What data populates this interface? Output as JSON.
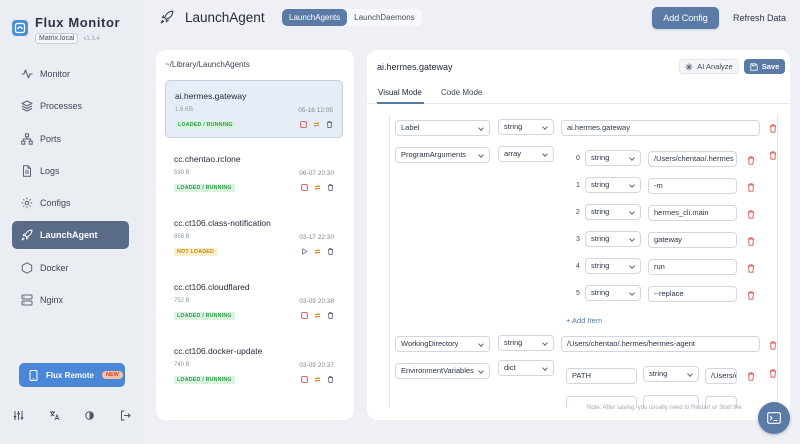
{
  "app": {
    "title": "Flux Monitor",
    "host": "Matrix.local",
    "version": "v1.3.4"
  },
  "nav": [
    {
      "label": "Monitor",
      "icon": "pulse-icon",
      "active": false
    },
    {
      "label": "Processes",
      "icon": "layers-icon",
      "active": false
    },
    {
      "label": "Ports",
      "icon": "network-icon",
      "active": false
    },
    {
      "label": "Logs",
      "icon": "file-icon",
      "active": false
    },
    {
      "label": "Configs",
      "icon": "gear-icon",
      "active": false
    },
    {
      "label": "LaunchAgent",
      "icon": "rocket-icon",
      "active": true
    },
    {
      "label": "Docker",
      "icon": "hexagon-icon",
      "active": false
    },
    {
      "label": "Nginx",
      "icon": "server-icon",
      "active": false
    }
  ],
  "remote": {
    "label": "Flux Remote",
    "badge": "NEW"
  },
  "footer_icons": [
    "sliders-icon",
    "translate-icon",
    "theme-icon",
    "logout-icon"
  ],
  "header": {
    "title": "LaunchAgent",
    "segments": [
      {
        "label": "LaunchAgents",
        "active": true
      },
      {
        "label": "LaunchDaemons",
        "active": false
      }
    ],
    "add_config": "Add Config",
    "refresh": "Refresh Data"
  },
  "list": {
    "path": "~/Library/LaunchAgents",
    "items": [
      {
        "name": "ai.hermes.gateway",
        "size": "1.6 KB",
        "date": "05-16 12:05",
        "status": "LOADED / RUNNING",
        "running": true,
        "selected": true
      },
      {
        "name": "cc.chentao.rclone",
        "size": "530 B",
        "date": "06-07 20:30",
        "status": "LOADED / RUNNING",
        "running": true,
        "selected": false
      },
      {
        "name": "cc.ct106.class-notification",
        "size": "858 B",
        "date": "03-17 22:30",
        "status": "NOT LOADED",
        "running": false,
        "selected": false
      },
      {
        "name": "cc.ct106.cloudflared",
        "size": "752 B",
        "date": "03-09 20:38",
        "status": "LOADED / RUNNING",
        "running": true,
        "selected": false
      },
      {
        "name": "cc.ct106.docker-update",
        "size": "740 B",
        "date": "03-09 20:37",
        "status": "LOADED / RUNNING",
        "running": true,
        "selected": false
      }
    ]
  },
  "detail": {
    "title": "ai.hermes.gateway",
    "ai_analyze": "AI Analyze",
    "save": "Save",
    "tabs": [
      {
        "label": "Visual Mode",
        "active": true
      },
      {
        "label": "Code Mode",
        "active": false
      }
    ],
    "rows": {
      "label": {
        "key": "Label",
        "type": "string",
        "value": "ai.hermes.gateway"
      },
      "program_arguments": {
        "key": "ProgramArguments",
        "type": "array",
        "items": [
          {
            "index": "0",
            "type": "string",
            "value": "/Users/chentao/.hermes"
          },
          {
            "index": "1",
            "type": "string",
            "value": "-m"
          },
          {
            "index": "2",
            "type": "string",
            "value": "hermes_cli.main"
          },
          {
            "index": "3",
            "type": "string",
            "value": "gateway"
          },
          {
            "index": "4",
            "type": "string",
            "value": "run"
          },
          {
            "index": "5",
            "type": "string",
            "value": "--replace"
          }
        ],
        "add_item": "+ Add Item"
      },
      "working_directory": {
        "key": "WorkingDirectory",
        "type": "string",
        "value": "/Users/chentao/.hermes/hermes-agent"
      },
      "environment_variables": {
        "key": "EnvironmentVariables",
        "type": "dict",
        "entries": [
          {
            "key": "PATH",
            "type": "string",
            "value": "/Users/c"
          }
        ]
      }
    },
    "footnote": "Note: After saving, you usually need to Restart or Start the"
  },
  "colors": {
    "accent": "#5a7ba6",
    "running": "#2e9a4c",
    "not_loaded": "#c38a14",
    "danger": "#d9534f",
    "brand": "#4e90d8"
  }
}
